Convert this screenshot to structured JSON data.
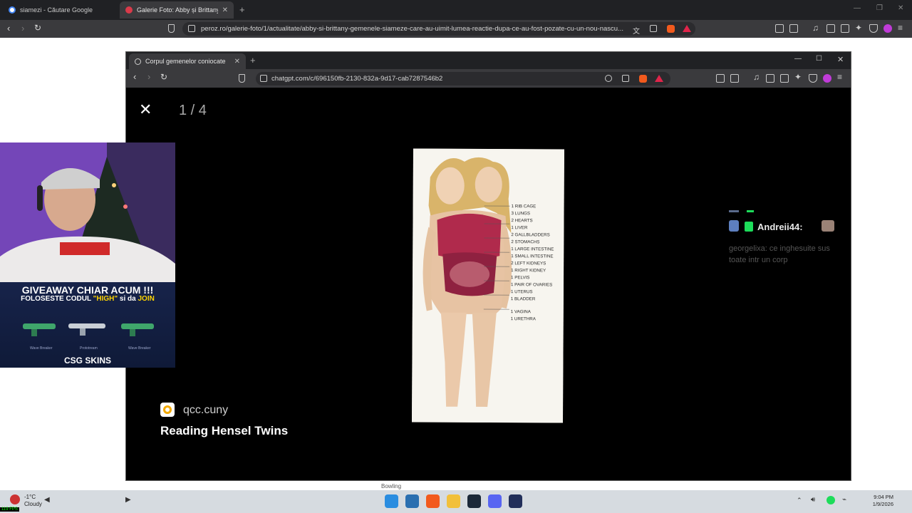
{
  "outer_browser": {
    "tabs": [
      {
        "title": "siamezi - Căutare Google",
        "active": false
      },
      {
        "title": "Galerie Foto: Abby și Brittany, ge",
        "active": true
      }
    ],
    "url": "peroz.ro/galerie-foto/1/actualitate/abby-si-brittany-gemenele-siameze-care-au-uimit-lumea-reactie-dupa-ce-au-fost-pozate-cu-un-nou-nascu..."
  },
  "inner_browser": {
    "tab_title": "Corpul gemenelor coniocate",
    "url": "chatgpt.com/c/696150fb-2130-832a-9d17-cab7287546b2"
  },
  "viewer": {
    "counter": "1 / 4",
    "image_labels": [
      "1 RIB CAGE",
      "3 LUNGS",
      "2 HEARTS",
      "1 LIVER",
      "2 GALLBLADDERS",
      "2 STOMACHS",
      "1 LARGE INTESTINE",
      "1 SMALL INTESTINE",
      "2 LEFT KIDNEYS",
      "1 RIGHT KIDNEY",
      "1 PELVIS",
      "1 PAIR OF OVARIES",
      "1 UTERUS",
      "1 BLADDER",
      "1 VAGINA",
      "1 URETHRA"
    ],
    "credit_source": "qcc.cuny",
    "credit_title": "Reading Hensel Twins"
  },
  "chat_overlay": {
    "username": "Andreii44:",
    "message": "georgelixa: ce inghesuite sus toate intr un corp"
  },
  "webcam_promo": {
    "line1": "GIVEAWAY CHIAR ACUM !!!",
    "line2_prefix": "FOLOSESTE CODUL ",
    "code": "\"HIGH\"",
    "line2_mid": " si da ",
    "join": "JOIN",
    "weapons": [
      "Wave Breaker",
      "Prototream",
      "Wave Breaker"
    ],
    "brand": "CSG SKINS"
  },
  "taskbar": {
    "temperature": "-1°C",
    "condition": "Cloudy",
    "hover_label": "Bowling",
    "time": "9:04 PM",
    "date": "1/9/2026",
    "fps": "119 FPS"
  }
}
